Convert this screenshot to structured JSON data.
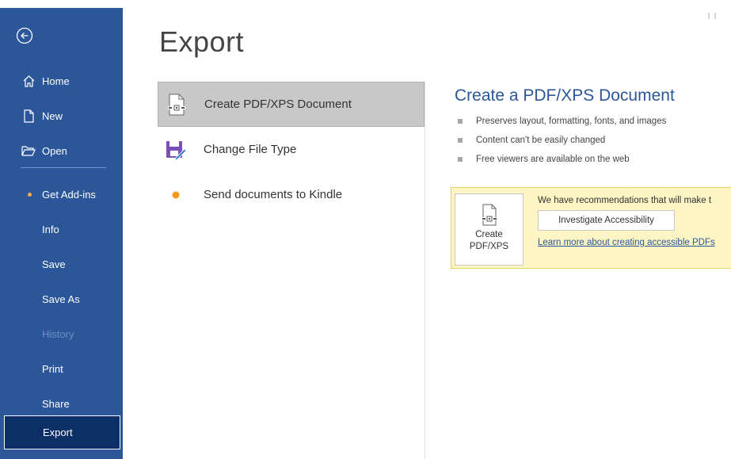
{
  "sidebar": {
    "items": [
      {
        "label": "Home"
      },
      {
        "label": "New"
      },
      {
        "label": "Open"
      },
      {
        "label": "Get Add-ins"
      },
      {
        "label": "Info"
      },
      {
        "label": "Save"
      },
      {
        "label": "Save As"
      },
      {
        "label": "History"
      },
      {
        "label": "Print"
      },
      {
        "label": "Share"
      },
      {
        "label": "Export"
      }
    ],
    "accent_color": "#2b579a",
    "active_bg": "#0b2f66"
  },
  "main": {
    "title": "Export",
    "options": [
      {
        "label": "Create PDF/XPS Document",
        "icon": "pdf-document-icon"
      },
      {
        "label": "Change File Type",
        "icon": "change-file-type-icon"
      },
      {
        "label": "Send documents to Kindle",
        "icon": "kindle-dot-icon"
      }
    ]
  },
  "detail": {
    "title": "Create a PDF/XPS Document",
    "bullets": [
      "Preserves layout, formatting, fonts, and images",
      "Content can't be easily changed",
      "Free viewers are available on the web"
    ],
    "tile_label_line1": "Create",
    "tile_label_line2": "PDF/XPS",
    "recommendation_text": "We have recommendations that will make t",
    "investigate_label": "Investigate Accessibility",
    "learn_more": "Learn more about creating accessible PDFs"
  }
}
